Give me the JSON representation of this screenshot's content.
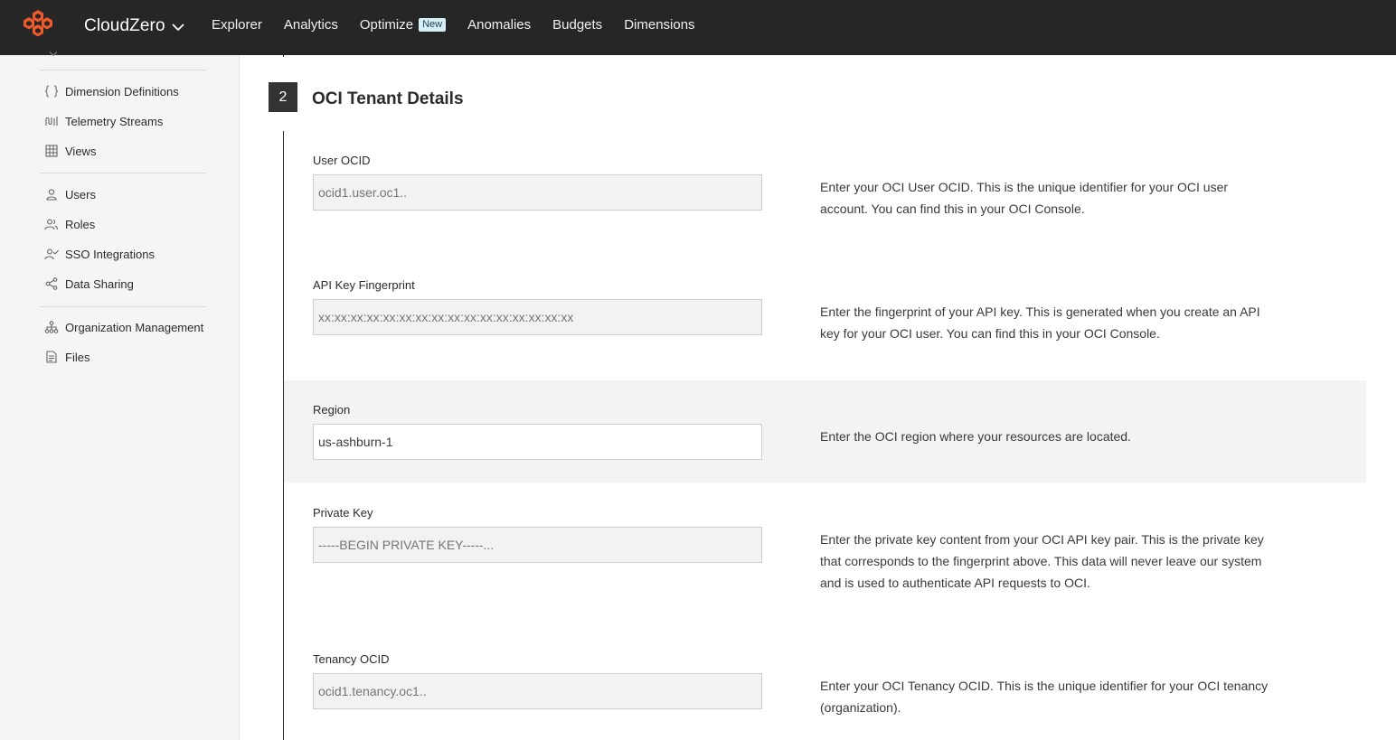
{
  "app": {
    "brand": "CloudZero",
    "colors": {
      "topbar": "#262626",
      "logo": "#ee5a2b",
      "badge_bg": "#d6eef5"
    }
  },
  "nav": {
    "items": [
      {
        "label": "Explorer"
      },
      {
        "label": "Analytics"
      },
      {
        "label": "Optimize",
        "badge": "New"
      },
      {
        "label": "Anomalies"
      },
      {
        "label": "Budgets"
      },
      {
        "label": "Dimensions"
      }
    ]
  },
  "sidebar": {
    "items": [
      {
        "label": "Dimension Definitions",
        "icon": "braces-icon"
      },
      {
        "label": "Telemetry Streams",
        "icon": "streams-icon"
      },
      {
        "label": "Views",
        "icon": "grid-table-icon"
      },
      {
        "label": "Users",
        "icon": "user-icon"
      },
      {
        "label": "Roles",
        "icon": "roles-icon"
      },
      {
        "label": "SSO Integrations",
        "icon": "user-check-icon"
      },
      {
        "label": "Data Sharing",
        "icon": "share-icon"
      },
      {
        "label": "Organization Management",
        "icon": "org-chart-icon"
      },
      {
        "label": "Files",
        "icon": "file-icon"
      }
    ]
  },
  "section": {
    "step": "2",
    "title": "OCI Tenant Details"
  },
  "fields": [
    {
      "label": "User OCID",
      "placeholder": "ocid1.user.oc1..",
      "value": "",
      "help": "Enter your OCI User OCID. This is the unique identifier for your OCI user account. You can find this in your OCI Console."
    },
    {
      "label": "API Key Fingerprint",
      "placeholder": "xx:xx:xx:xx:xx:xx:xx:xx:xx:xx:xx:xx:xx:xx:xx:xx",
      "value": "",
      "help": "Enter the fingerprint of your API key. This is generated when you create an API key for your OCI user. You can find this in your OCI Console."
    },
    {
      "label": "Region",
      "placeholder": "",
      "value": "us-ashburn-1",
      "help": "Enter the OCI region where your resources are located."
    },
    {
      "label": "Private Key",
      "placeholder": "-----BEGIN PRIVATE KEY-----...",
      "value": "",
      "help": "Enter the private key content from your OCI API key pair. This is the private key that corresponds to the fingerprint above. This data will never leave our system and is used to authenticate API requests to OCI."
    },
    {
      "label": "Tenancy OCID",
      "placeholder": "ocid1.tenancy.oc1..",
      "value": "",
      "help": "Enter your OCI Tenancy OCID. This is the unique identifier for your OCI tenancy (organization)."
    }
  ]
}
